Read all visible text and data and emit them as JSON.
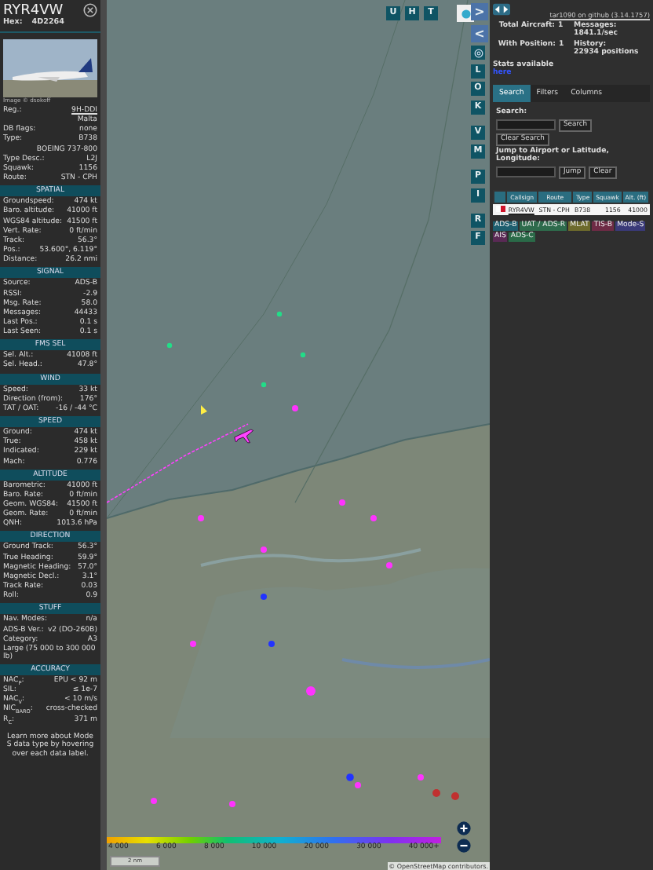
{
  "detail_panel": {
    "callsign": "RYR4VW",
    "hex_label": "Hex:",
    "hex": "4D2264",
    "photo_credit": "Image © dsokoff",
    "rows": [
      {
        "kind": "pair",
        "label": "Reg.:",
        "value": "9H-DDI",
        "link": true
      },
      {
        "kind": "value",
        "value": "Malta"
      },
      {
        "kind": "pair",
        "label": "DB flags:",
        "value": "none",
        "link": false
      },
      {
        "kind": "pair",
        "label": "Type:",
        "value": "B738",
        "link": false
      },
      {
        "kind": "value",
        "value": "BOEING 737-800"
      },
      {
        "kind": "pair",
        "label": "Type Desc.:",
        "value": "L2J",
        "link": false
      },
      {
        "kind": "pair",
        "label": "Squawk:",
        "value": "1156",
        "link": false
      },
      {
        "kind": "pair",
        "label": "Route:",
        "value": "STN - CPH",
        "link": false
      }
    ],
    "sections": [
      {
        "title": "SPATIAL",
        "rows": [
          {
            "kind": "pair",
            "label": "Groundspeed:",
            "value": "474 kt"
          },
          {
            "kind": "pair",
            "label": "Baro. altitude:",
            "value": "41000 ft"
          },
          {
            "kind": "pair",
            "label": "WGS84 altitude:",
            "value": "41500 ft"
          },
          {
            "kind": "pair",
            "label": "Vert. Rate:",
            "value": "0 ft/min"
          },
          {
            "kind": "pair",
            "label": "Track:",
            "value": "56.3°"
          },
          {
            "kind": "pair",
            "label": "Pos.:",
            "value": "53.600°, 6.119°"
          },
          {
            "kind": "pair",
            "label": "Distance:",
            "value": "26.2 nmi"
          }
        ]
      },
      {
        "title": "SIGNAL",
        "rows": [
          {
            "kind": "pair",
            "label": "Source:",
            "value": "ADS-B"
          },
          {
            "kind": "pair",
            "label": "RSSI:",
            "value": "-2.9"
          },
          {
            "kind": "pair",
            "label": "Msg. Rate:",
            "value": "58.0"
          },
          {
            "kind": "pair",
            "label": "Messages:",
            "value": "44433"
          },
          {
            "kind": "pair",
            "label": "Last Pos.:",
            "value": "0.1 s"
          },
          {
            "kind": "pair",
            "label": "Last Seen:",
            "value": "0.1 s"
          }
        ]
      },
      {
        "title": "FMS SEL",
        "rows": [
          {
            "kind": "pair",
            "label": "Sel. Alt.:",
            "value": "41008 ft"
          },
          {
            "kind": "pair",
            "label": "Sel. Head.:",
            "value": "47.8°"
          }
        ]
      },
      {
        "title": "WIND",
        "rows": [
          {
            "kind": "pair",
            "label": "Speed:",
            "value": "33 kt"
          },
          {
            "kind": "pair",
            "label": "Direction (from):",
            "value": "176°"
          },
          {
            "kind": "pair",
            "label": "TAT / OAT:",
            "value": "-16 / -44 °C"
          }
        ]
      },
      {
        "title": "SPEED",
        "rows": [
          {
            "kind": "pair",
            "label": "Ground:",
            "value": "474 kt"
          },
          {
            "kind": "pair",
            "label": "True:",
            "value": "458 kt"
          },
          {
            "kind": "pair",
            "label": "Indicated:",
            "value": "229 kt"
          },
          {
            "kind": "pair",
            "label": "Mach:",
            "value": "0.776"
          }
        ]
      },
      {
        "title": "ALTITUDE",
        "rows": [
          {
            "kind": "pair",
            "label": "Barometric:",
            "value": "41000 ft"
          },
          {
            "kind": "pair",
            "label": "Baro. Rate:",
            "value": "0 ft/min"
          },
          {
            "kind": "pair",
            "label": "Geom. WGS84:",
            "value": "41500 ft"
          },
          {
            "kind": "pair",
            "label": "Geom. Rate:",
            "value": "0 ft/min"
          },
          {
            "kind": "pair",
            "label": "QNH:",
            "value": "1013.6 hPa"
          }
        ]
      },
      {
        "title": "DIRECTION",
        "rows": [
          {
            "kind": "pair",
            "label": "Ground Track:",
            "value": "56.3°"
          },
          {
            "kind": "pair",
            "label": "True Heading:",
            "value": "59.9°"
          },
          {
            "kind": "pair",
            "label": "Magnetic Heading:",
            "value": "57.0°"
          },
          {
            "kind": "pair",
            "label": "Magnetic Decl.:",
            "value": "3.1°"
          },
          {
            "kind": "pair",
            "label": "Track Rate:",
            "value": "0.03"
          },
          {
            "kind": "pair",
            "label": "Roll:",
            "value": "0.9"
          }
        ]
      },
      {
        "title": "STUFF",
        "rows": [
          {
            "kind": "pair",
            "label": "Nav. Modes:",
            "value": "n/a"
          },
          {
            "kind": "pair",
            "label": "ADS-B Ver.:",
            "value": "v2 (DO-260B)"
          },
          {
            "kind": "pair",
            "label": "Category:",
            "value": "A3"
          },
          {
            "kind": "text",
            "value": "Large (75 000 to 300 000 lb)"
          }
        ]
      },
      {
        "title": "ACCURACY",
        "rows": [
          {
            "kind": "pair",
            "label": "NAC$_{P}$:",
            "value": "EPU < 92 m"
          },
          {
            "kind": "pair",
            "label": "SIL:",
            "value": "≤ 1e-7"
          },
          {
            "kind": "pair",
            "label": "NAC$_{V}$:",
            "value": "< 10 m/s"
          },
          {
            "kind": "pair",
            "label": "NIC$_{BARO}$:",
            "value": "cross-checked"
          },
          {
            "kind": "pair",
            "label": "R$_{C}$:",
            "value": "371 m"
          }
        ]
      }
    ],
    "footnote": "Learn more about Mode S data type by hovering over each data label."
  },
  "map": {
    "top_buttons": [
      "U",
      "H",
      "T"
    ],
    "side_buttons": [
      {
        "kind": "arrow",
        "label": ">"
      },
      {
        "kind": "arrow",
        "label": "<"
      },
      {
        "kind": "gear"
      },
      {
        "kind": "letter",
        "label": "L"
      },
      {
        "kind": "letter",
        "label": "O"
      },
      {
        "kind": "letter",
        "label": "K"
      },
      {
        "kind": "gap"
      },
      {
        "kind": "letter",
        "label": "V"
      },
      {
        "kind": "letter",
        "label": "M"
      },
      {
        "kind": "gap"
      },
      {
        "kind": "letter",
        "label": "P"
      },
      {
        "kind": "letter",
        "label": "I"
      },
      {
        "kind": "gap"
      },
      {
        "kind": "letter",
        "label": "R"
      },
      {
        "kind": "letter",
        "label": "F"
      }
    ],
    "altitude_ticks": [
      "4 000",
      "6 000",
      "8 000",
      "10 000",
      "20 000",
      "30 000",
      "40 000+"
    ],
    "scale": "2 nm",
    "attribution": "© OpenStreetMap contributors."
  },
  "side_panel": {
    "version_link": "tar1090 on github (3.14.1757)",
    "stats": [
      {
        "label": "Total Aircraft:",
        "value": "1"
      },
      {
        "label": "Messages:",
        "value": "1841.1/sec"
      },
      {
        "label": "With Position:",
        "value": "1"
      },
      {
        "label": "History:",
        "value": "22934 positions"
      }
    ],
    "stats_text": "Stats available",
    "stats_link": "here",
    "tabs": [
      {
        "label": "Search",
        "selected": true
      },
      {
        "label": "Filters",
        "selected": false
      },
      {
        "label": "Columns",
        "selected": false
      }
    ],
    "search_label": "Search:",
    "search_button": "Search",
    "clear_search_button": "Clear Search",
    "jump_label": "Jump to Airport or Latitude, Longitude:",
    "jump_button": "Jump",
    "clear_button": "Clear",
    "columns": [
      "Callsign",
      "Route",
      "Type",
      "Squawk",
      "Alt. (ft)"
    ],
    "rows": [
      {
        "callsign": "RYR4VW",
        "route": "STN - CPH",
        "type": "B738",
        "squawk": "1156",
        "altitude": "41000",
        "selected": false
      }
    ],
    "sources": [
      {
        "label": "ADS-B",
        "color": "#1d5e6e"
      },
      {
        "label": "UAT / ADS-R",
        "color": "#2e6b4c"
      },
      {
        "label": "MLAT",
        "color": "#6d6a2c"
      },
      {
        "label": "TIS-B",
        "color": "#6e2b45"
      },
      {
        "label": "Mode-S",
        "color": "#3a3a78"
      },
      {
        "label": "AIS",
        "color": "#5a2a55"
      },
      {
        "label": "ADS-C",
        "color": "#2a6a48"
      }
    ]
  }
}
